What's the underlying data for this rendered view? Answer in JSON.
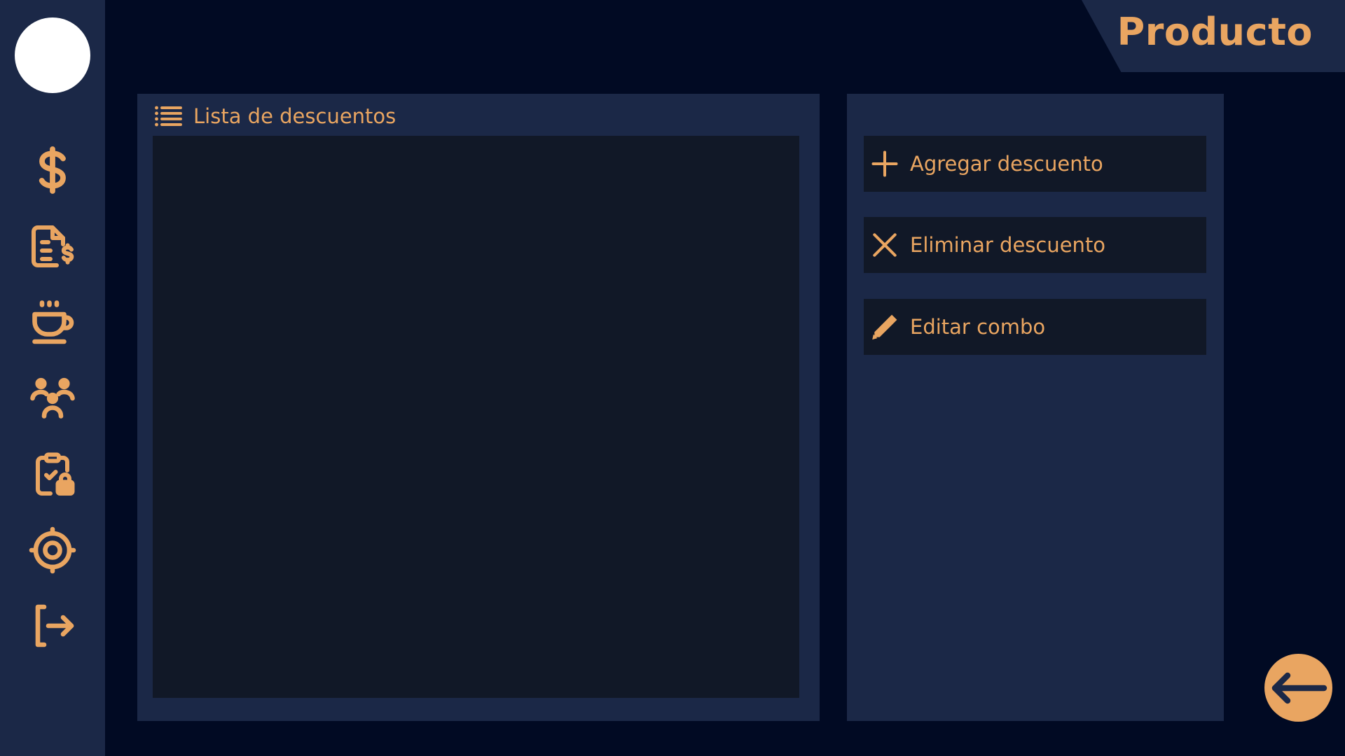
{
  "header": {
    "title": "Producto"
  },
  "sidebar": {
    "items": [
      {
        "icon": "dollar-icon"
      },
      {
        "icon": "invoice-icon"
      },
      {
        "icon": "coffee-cup-icon"
      },
      {
        "icon": "users-icon"
      },
      {
        "icon": "clipboard-lock-icon"
      },
      {
        "icon": "settings-icon"
      },
      {
        "icon": "logout-icon"
      }
    ]
  },
  "discount_list": {
    "title": "Lista de descuentos",
    "icon": "list-icon",
    "items": []
  },
  "actions": {
    "add_label": "Agregar descuento",
    "delete_label": "Eliminar descuento",
    "edit_label": "Editar combo"
  },
  "colors": {
    "background": "#010a23",
    "panel": "#1b2847",
    "inset": "#111827",
    "accent": "#e9a561",
    "avatar": "#ffffff"
  }
}
